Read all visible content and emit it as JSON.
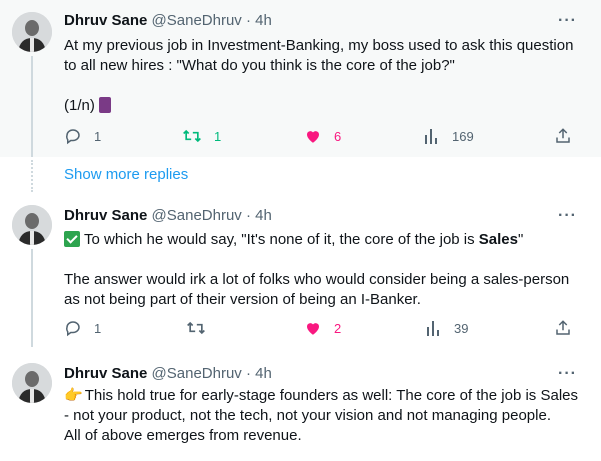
{
  "tweets": [
    {
      "name": "Dhruv Sane",
      "handle": "@SaneDhruv",
      "dot": "·",
      "time": "4h",
      "lines": [
        "At my previous job in Investment-Banking, my boss used to ask this question",
        "to all new hires : \"What do you think is the core of the job?\"",
        "",
        "(1/n)"
      ],
      "emoji": "thread-spool-emoji",
      "replies": "1",
      "retweets": "1",
      "likes": "6",
      "views": "169",
      "liked": true,
      "retweet_active": true
    },
    {
      "name": "Dhruv Sane",
      "handle": "@SaneDhruv",
      "dot": "·",
      "time": "4h",
      "line1_prefix": "To which he would say, \"It's none of it, the core of the job is ",
      "line1_bold": "Sales",
      "line1_suffix": "\"",
      "lines": [
        "",
        "The answer would irk a lot of folks who would consider being a sales-person",
        "as not being part of their version of being an I-Banker."
      ],
      "replies": "1",
      "retweets": "",
      "likes": "2",
      "views": "39",
      "liked": true,
      "retweet_active": false
    },
    {
      "name": "Dhruv Sane",
      "handle": "@SaneDhruv",
      "dot": "·",
      "time": "4h",
      "finger": "👉",
      "line1": "This hold true for early-stage founders as well: The core of the job is Sales",
      "lines": [
        "- not your product, not the tech, not your vision and not managing people.",
        "All of above emerges from revenue."
      ]
    }
  ],
  "show_more_replies": "Show more replies",
  "more_glyph": "···",
  "colors": {
    "like": "#f91880",
    "retweet": "#00ba7c",
    "link": "#1d9bf0",
    "muted": "#536471"
  }
}
